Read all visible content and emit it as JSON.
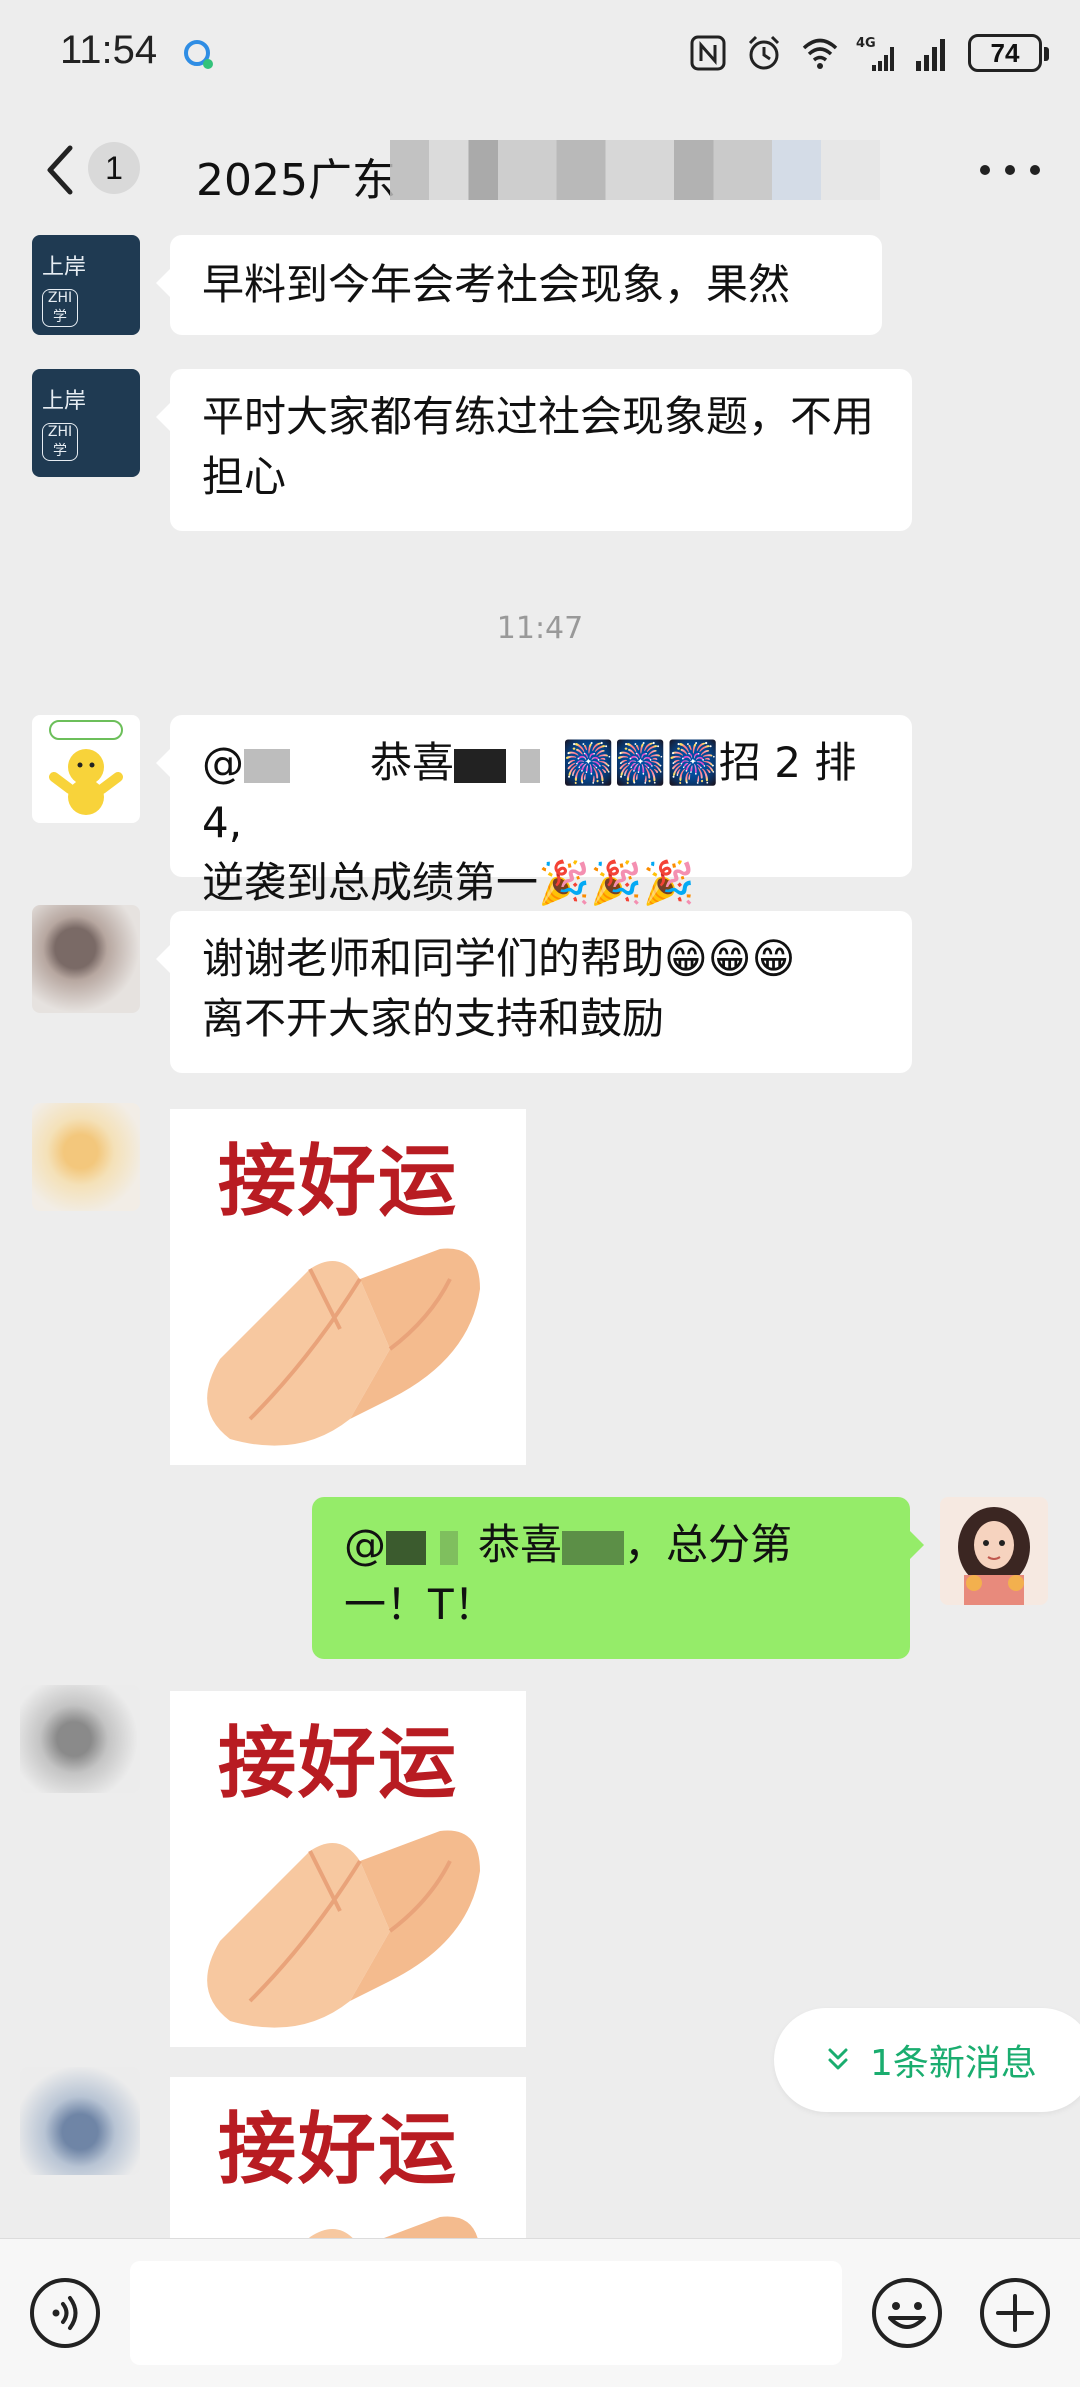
{
  "status_bar": {
    "time": "11:54",
    "battery": "74",
    "icons": [
      "nfc-icon",
      "alarm-icon",
      "wifi-icon",
      "4g-signal-icon",
      "signal-icon"
    ]
  },
  "header": {
    "unread_count": "1",
    "title": "2025广东"
  },
  "messages": {
    "m1": "早料到今年会考社会现象，果然",
    "m2": "平时大家都有练过社会现象题，不用担心",
    "timestamp": "11:47",
    "m3_prefix": "@",
    "m3_congrats": "恭喜",
    "m3_text": "招 2 排 4,",
    "m3_line2": "逆袭到总成绩第一",
    "m4_line1": "谢谢老师和同学们的帮助",
    "m4_line2": "离不开大家的支持和鼓励",
    "m5_prefix": "@",
    "m5_congrats": "恭喜",
    "m5_text": "，总分第",
    "m5_line2": "一！T！"
  },
  "avatar1": {
    "line1": "上岸",
    "line2": "ZHI学"
  },
  "sticker_text": "接好运",
  "new_message_pill": {
    "label": "1条新消息"
  },
  "emoji": {
    "fireworks": "🎆🎆🎆",
    "party": "🎉🎉🎉",
    "grin": "😁😁😁"
  },
  "input": {
    "placeholder": ""
  },
  "colors": {
    "my_bubble": "#95ec69",
    "accent_green": "#1aad6f",
    "sticker_red": "#b81c22"
  }
}
